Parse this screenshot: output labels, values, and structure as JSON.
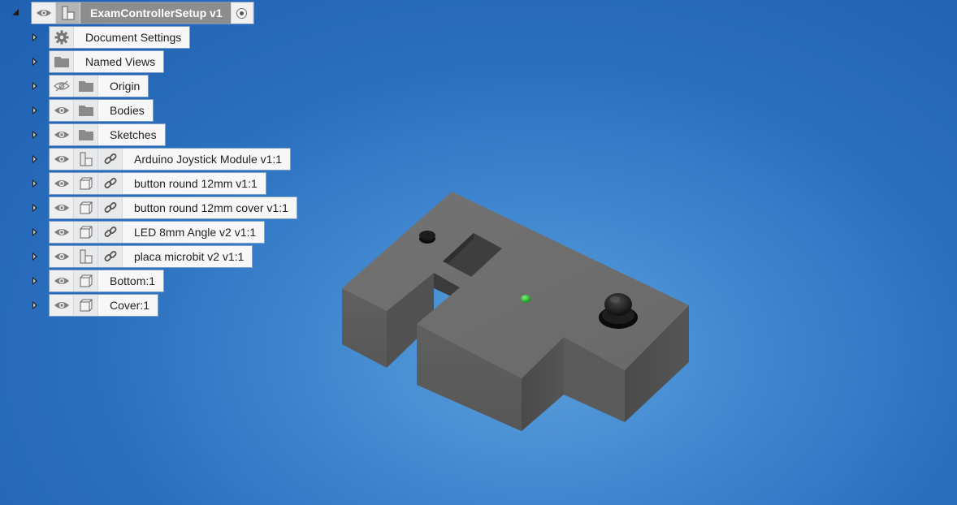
{
  "browser": {
    "root": {
      "label": "ExamControllerSetup v1",
      "icons": [
        "eye-icon",
        "component-icon",
        "activate-radio-icon"
      ]
    },
    "items": [
      {
        "label": "Document Settings",
        "icons": [
          "gear-icon"
        ]
      },
      {
        "label": "Named Views",
        "icons": [
          "folder-icon"
        ]
      },
      {
        "label": "Origin",
        "icons": [
          "eye-hidden-icon",
          "folder-icon"
        ]
      },
      {
        "label": "Bodies",
        "icons": [
          "eye-icon",
          "folder-icon"
        ]
      },
      {
        "label": "Sketches",
        "icons": [
          "eye-icon",
          "folder-icon"
        ]
      },
      {
        "label": "Arduino Joystick Module v1:1",
        "icons": [
          "eye-icon",
          "assembly-icon",
          "link-icon"
        ]
      },
      {
        "label": "button round 12mm v1:1",
        "icons": [
          "eye-icon",
          "component-icon",
          "link-icon"
        ]
      },
      {
        "label": "button round 12mm cover v1:1",
        "icons": [
          "eye-icon",
          "component-icon",
          "link-icon"
        ]
      },
      {
        "label": "LED 8mm Angle v2 v1:1",
        "icons": [
          "eye-icon",
          "component-icon",
          "link-icon"
        ]
      },
      {
        "label": "placa microbit v2 v1:1",
        "icons": [
          "eye-icon",
          "assembly-icon",
          "link-icon"
        ]
      },
      {
        "label": "Bottom:1",
        "icons": [
          "eye-icon",
          "component-icon"
        ]
      },
      {
        "label": "Cover:1",
        "icons": [
          "eye-icon",
          "component-icon"
        ]
      }
    ]
  },
  "model": {
    "colors": {
      "top": "#6e6e6e",
      "left": "#5a5a5a",
      "right": "#4c4c4c",
      "led": "#2fb82f",
      "button": "#111111",
      "background": "#2a6fbe"
    }
  }
}
